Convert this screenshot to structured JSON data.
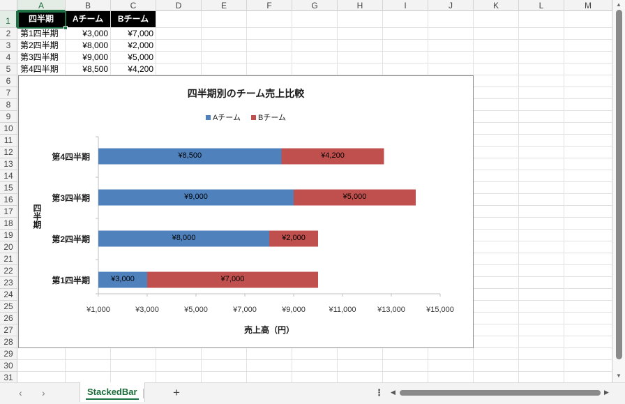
{
  "sheet": {
    "columns": [
      "A",
      "B",
      "C",
      "D",
      "E",
      "F",
      "G",
      "H",
      "I",
      "J",
      "K",
      "L",
      "M"
    ],
    "rows": [
      "1",
      "2",
      "3",
      "4",
      "5",
      "6",
      "7",
      "8",
      "9",
      "10",
      "11",
      "12",
      "13",
      "14",
      "15",
      "16",
      "17",
      "18",
      "19",
      "20",
      "21",
      "22",
      "23",
      "24",
      "25",
      "26",
      "27",
      "28",
      "29",
      "30",
      "31"
    ],
    "selected_column": "A",
    "selected_row": "1",
    "header_cells": [
      "四半期",
      "Aチーム",
      "Bチーム"
    ],
    "data_rows": [
      [
        "第1四半期",
        "¥3,000",
        "¥7,000"
      ],
      [
        "第2四半期",
        "¥8,000",
        "¥2,000"
      ],
      [
        "第3四半期",
        "¥9,000",
        "¥5,000"
      ],
      [
        "第4四半期",
        "¥8,500",
        "¥4,200"
      ]
    ]
  },
  "chart_data": {
    "type": "bar",
    "orientation": "horizontal",
    "stacked": true,
    "title": "四半期別のチーム売上比較",
    "categories": [
      "第1四半期",
      "第2四半期",
      "第3四半期",
      "第4四半期"
    ],
    "series": [
      {
        "name": "Aチーム",
        "values": [
          3000,
          8000,
          9000,
          8500
        ],
        "labels": [
          "¥3,000",
          "¥8,000",
          "¥9,000",
          "¥8,500"
        ],
        "color": "#4f81bd"
      },
      {
        "name": "Bチーム",
        "values": [
          7000,
          2000,
          5000,
          4200
        ],
        "labels": [
          "¥7,000",
          "¥2,000",
          "¥5,000",
          "¥4,200"
        ],
        "color": "#c0504d"
      }
    ],
    "xlabel": "売上高（円）",
    "ylabel": "四半期",
    "xlim": [
      1000,
      15000
    ],
    "xticks": [
      1000,
      3000,
      5000,
      7000,
      9000,
      11000,
      13000,
      15000
    ],
    "xtick_labels": [
      "¥1,000",
      "¥3,000",
      "¥5,000",
      "¥7,000",
      "¥9,000",
      "¥11,000",
      "¥13,000",
      "¥15,000"
    ],
    "legend_position": "top",
    "grid": false
  },
  "tabs": {
    "sheets": [
      "StackedBar"
    ],
    "active": "StackedBar",
    "add_label": "+",
    "prev_icon": "‹",
    "next_icon": "›",
    "more_label": "⋮"
  },
  "scroll": {
    "up_icon": "▲",
    "down_icon": "▼",
    "left_icon": "◀",
    "right_icon": "▶"
  }
}
